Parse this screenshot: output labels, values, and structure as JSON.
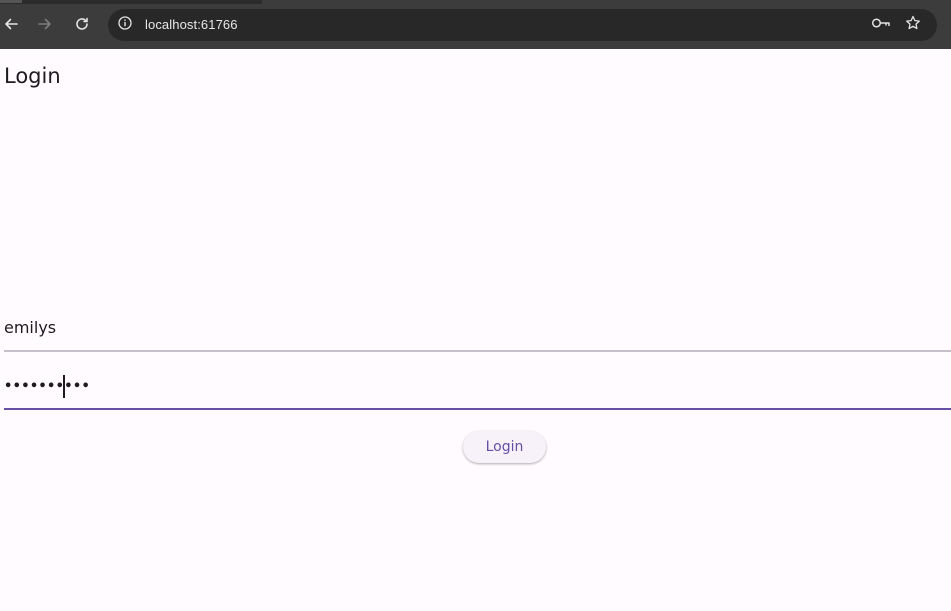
{
  "browser": {
    "url": "localhost:61766",
    "icons": {
      "back": "arrow-left-icon",
      "forward": "arrow-right-icon",
      "reload": "reload-icon",
      "site_info": "info-circle-icon",
      "password_key": "key-icon",
      "bookmark": "star-icon"
    },
    "colors": {
      "toolbar": "#3c3c3c",
      "omnibox": "#282828"
    }
  },
  "app": {
    "title": "Login",
    "form": {
      "username_value": "emilys",
      "password_masked": "••••••••••",
      "submit_label": "Login"
    },
    "colors": {
      "background": "#fffbff",
      "primary": "#6750a4",
      "inactive_underline": "#c4bfc8",
      "button_bg": "#f7f2fa"
    }
  }
}
